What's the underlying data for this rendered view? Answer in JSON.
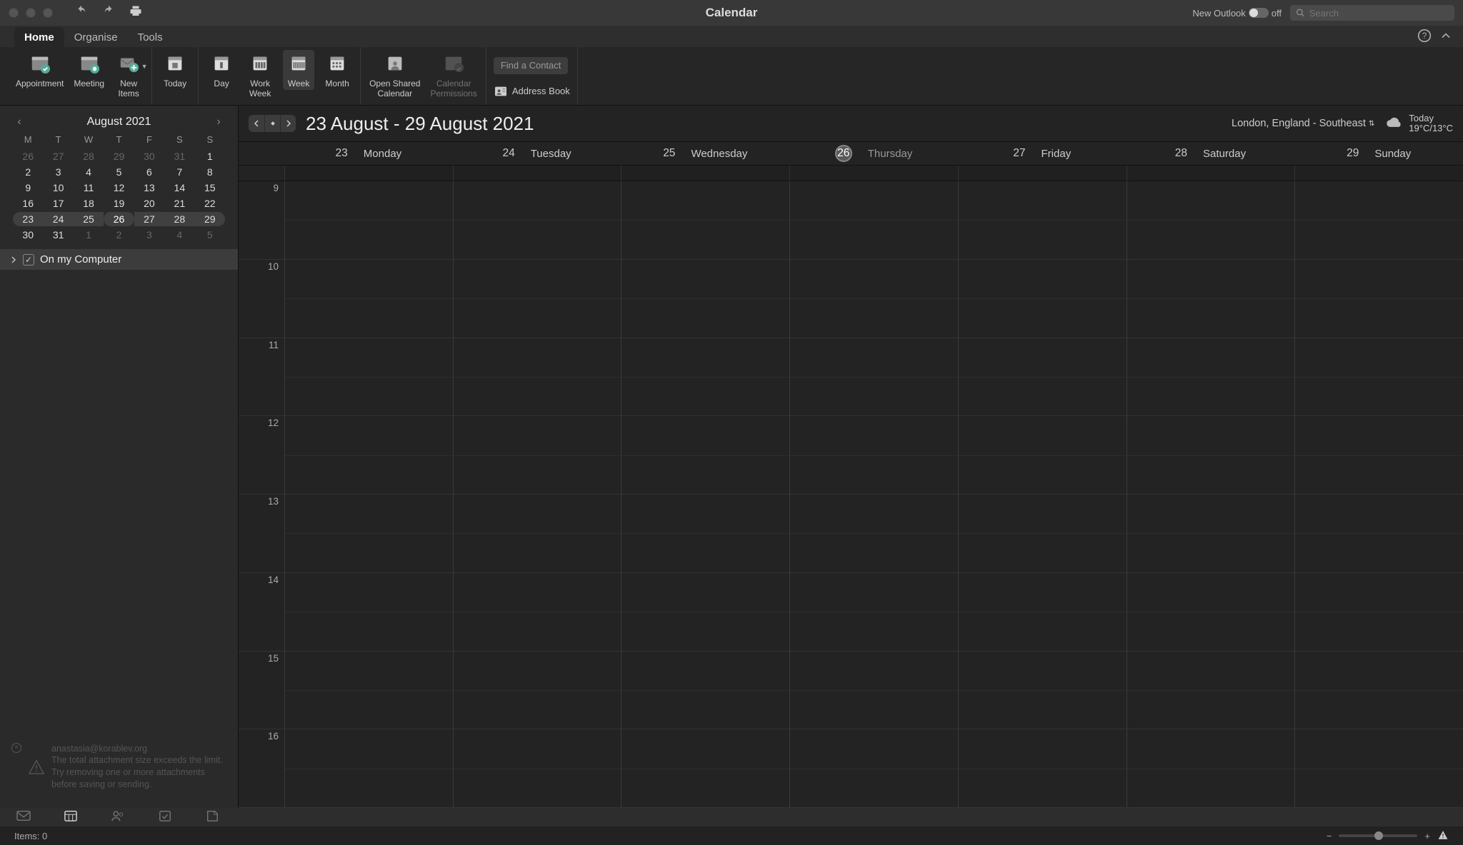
{
  "window": {
    "title": "Calendar"
  },
  "titlebar": {
    "new_outlook": "New Outlook",
    "toggle_state": "off",
    "search_placeholder": "Search"
  },
  "app_tabs": {
    "items": [
      "Home",
      "Organise",
      "Tools"
    ],
    "active": 0
  },
  "ribbon": {
    "appointment": "Appointment",
    "meeting": "Meeting",
    "new_items": "New\nItems",
    "today": "Today",
    "day": "Day",
    "work_week": "Work\nWeek",
    "week": "Week",
    "month": "Month",
    "open_shared": "Open Shared\nCalendar",
    "permissions": "Calendar\nPermissions",
    "find_contact": "Find a Contact",
    "address_book": "Address Book"
  },
  "mini_calendar": {
    "title": "August 2021",
    "dow": [
      "M",
      "T",
      "W",
      "T",
      "F",
      "S",
      "S"
    ],
    "rows": [
      {
        "days": [
          "26",
          "27",
          "28",
          "29",
          "30",
          "31",
          "1"
        ],
        "off": [
          0,
          1,
          2,
          3,
          4,
          5
        ]
      },
      {
        "days": [
          "2",
          "3",
          "4",
          "5",
          "6",
          "7",
          "8"
        ],
        "off": []
      },
      {
        "days": [
          "9",
          "10",
          "11",
          "12",
          "13",
          "14",
          "15"
        ],
        "off": []
      },
      {
        "days": [
          "16",
          "17",
          "18",
          "19",
          "20",
          "21",
          "22"
        ],
        "off": []
      },
      {
        "days": [
          "23",
          "24",
          "25",
          "26",
          "27",
          "28",
          "29"
        ],
        "off": [],
        "selected": true,
        "today_idx": 3
      },
      {
        "days": [
          "30",
          "31",
          "1",
          "2",
          "3",
          "4",
          "5"
        ],
        "off": [
          2,
          3,
          4,
          5,
          6
        ]
      }
    ]
  },
  "sidebar": {
    "calendar_list_label": "On my Computer",
    "error_x": "×",
    "error_email": "anastasia@korablev.org",
    "error_msg": "The total attachment size exceeds the limit. Try removing one or more attachments before saving or sending."
  },
  "main": {
    "range_title": "23 August - 29 August 2021",
    "location": "London, England - Southeast",
    "weather_label": "Today",
    "weather_temp": "19°C/13°C",
    "days": [
      {
        "num": "23",
        "name": "Monday"
      },
      {
        "num": "24",
        "name": "Tuesday"
      },
      {
        "num": "25",
        "name": "Wednesday"
      },
      {
        "num": "26",
        "name": "Thursday",
        "today": true
      },
      {
        "num": "27",
        "name": "Friday"
      },
      {
        "num": "28",
        "name": "Saturday"
      },
      {
        "num": "29",
        "name": "Sunday"
      }
    ],
    "hours": [
      "9",
      "10",
      "11",
      "12",
      "13",
      "14",
      "15",
      "16"
    ]
  },
  "status": {
    "items_label": "Items: 0"
  }
}
